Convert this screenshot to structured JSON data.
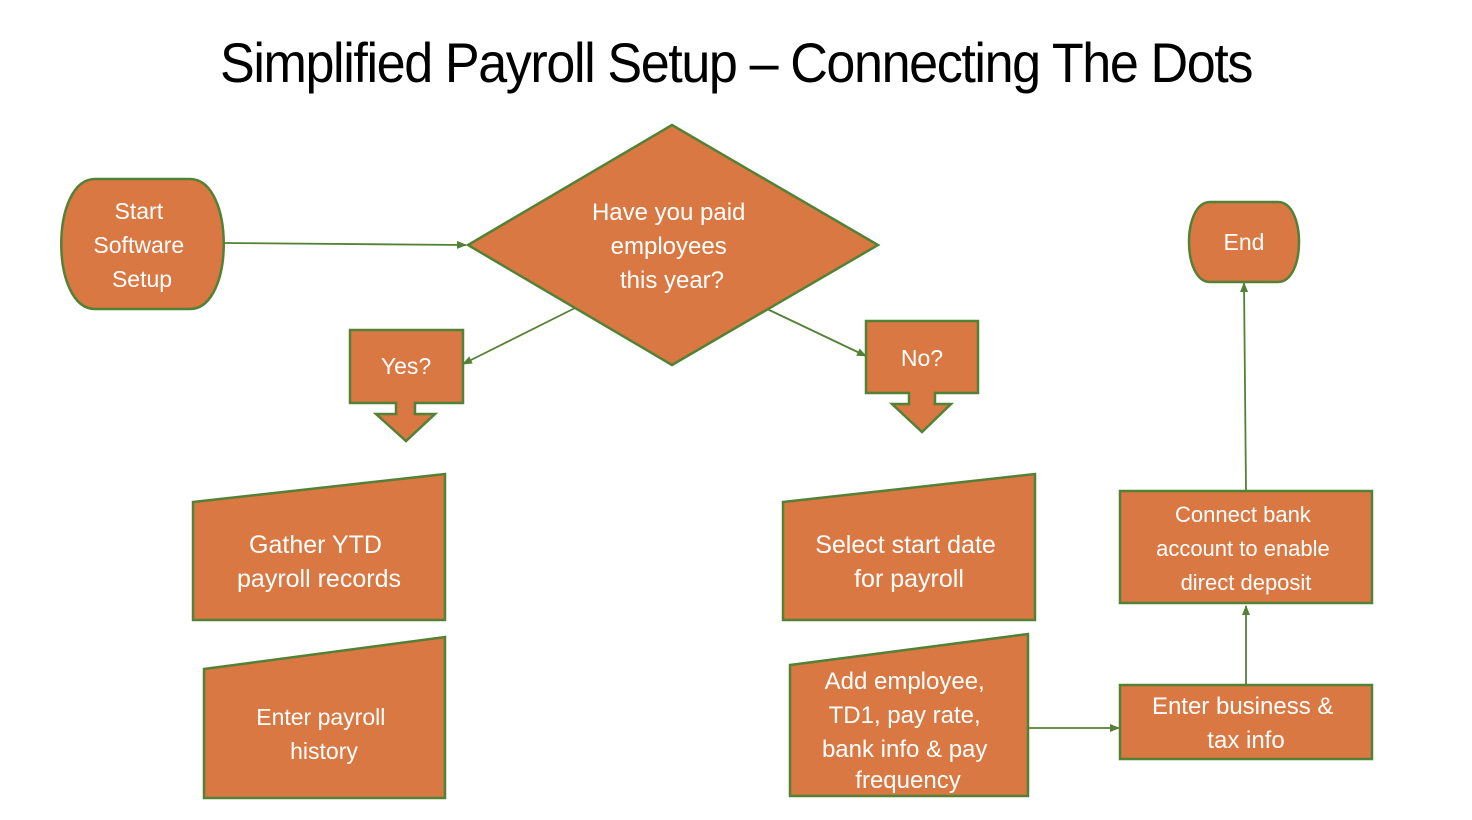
{
  "title": "Simplified Payroll Setup – Connecting The Dots",
  "colors": {
    "shape_fill": "#D97842",
    "shape_stroke": "#538135",
    "connector": "#538135",
    "text": "#FFFFFF"
  },
  "nodes": {
    "start": {
      "type": "terminator",
      "lines": [
        "Start",
        "Software",
        "Setup"
      ]
    },
    "decision": {
      "type": "decision",
      "lines": [
        "Have you paid",
        "employees",
        "this year?"
      ]
    },
    "yes": {
      "type": "offpage-callout",
      "lines": [
        "Yes?"
      ]
    },
    "no": {
      "type": "offpage-callout",
      "lines": [
        "No?"
      ]
    },
    "gather_ytd": {
      "type": "manual-input",
      "lines": [
        "Gather YTD",
        "payroll records"
      ]
    },
    "enter_history": {
      "type": "manual-input",
      "lines": [
        "Enter payroll",
        "history"
      ]
    },
    "select_start": {
      "type": "manual-input",
      "lines": [
        "Select start date",
        "for payroll"
      ]
    },
    "add_employee": {
      "type": "manual-input",
      "lines": [
        "Add employee,",
        "TD1, pay rate,",
        "bank info & pay",
        "frequency"
      ]
    },
    "business_tax": {
      "type": "process",
      "lines": [
        "Enter business &",
        "tax info"
      ]
    },
    "connect_bank": {
      "type": "process",
      "lines": [
        "Connect bank",
        "account to enable",
        "direct deposit"
      ]
    },
    "end": {
      "type": "terminator",
      "lines": [
        "End"
      ]
    }
  },
  "edges": [
    {
      "from": "start",
      "to": "decision"
    },
    {
      "from": "decision",
      "to": "yes"
    },
    {
      "from": "decision",
      "to": "no"
    },
    {
      "from": "add_employee",
      "to": "business_tax"
    },
    {
      "from": "business_tax",
      "to": "connect_bank"
    },
    {
      "from": "connect_bank",
      "to": "end"
    }
  ]
}
